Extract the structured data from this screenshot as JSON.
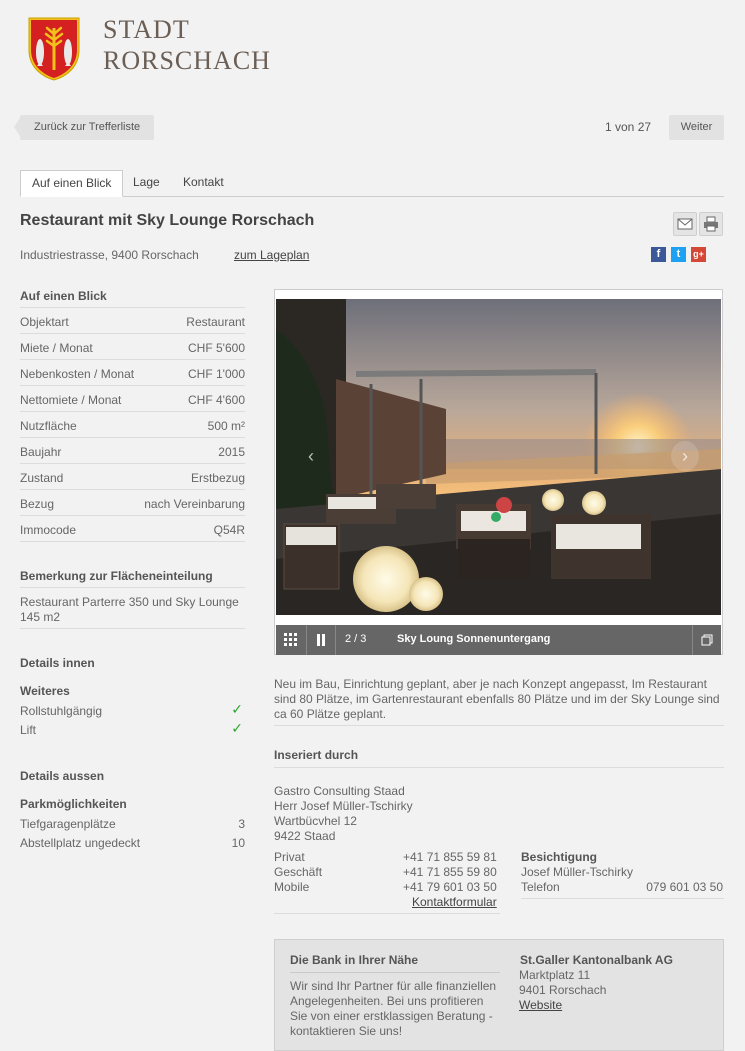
{
  "header": {
    "brand_line1": "STADT",
    "brand_line2": "RORSCHACH"
  },
  "nav": {
    "back_label": "Zurück zur Trefferliste",
    "pager": "1 von 27",
    "next_label": "Weiter"
  },
  "tabs": [
    {
      "label": "Auf einen Blick"
    },
    {
      "label": "Lage"
    },
    {
      "label": "Kontakt"
    }
  ],
  "listing": {
    "title": "Restaurant mit Sky Lounge Rorschach",
    "address": "Industriestrasse, 9400 Rorschach",
    "map_link": "zum Lageplan"
  },
  "social": {
    "facebook": "f",
    "twitter": "t",
    "google": "g+"
  },
  "overview": {
    "heading": "Auf einen Blick",
    "rows": [
      {
        "label": "Objektart",
        "value": "Restaurant"
      },
      {
        "label": "Miete / Monat",
        "value": "CHF 5'600"
      },
      {
        "label": "Nebenkosten / Monat",
        "value": "CHF 1'000"
      },
      {
        "label": "Nettomiete / Monat",
        "value": "CHF 4'600"
      },
      {
        "label": "Nutzfläche",
        "value": "500 m²"
      },
      {
        "label": "Baujahr",
        "value": "2015"
      },
      {
        "label": "Zustand",
        "value": "Erstbezug"
      },
      {
        "label": "Bezug",
        "value": "nach Vereinbarung"
      },
      {
        "label": "Immocode",
        "value": "Q54R"
      }
    ]
  },
  "floor_note": {
    "heading": "Bemerkung zur Flächeneinteilung",
    "text": "Restaurant Parterre 350 und Sky Lounge 145 m2"
  },
  "details_inside": {
    "heading": "Details innen",
    "subheading": "Weiteres",
    "rows": [
      {
        "label": "Rollstuhlgängig",
        "value": "✓"
      },
      {
        "label": "Lift",
        "value": "✓"
      }
    ]
  },
  "details_outside": {
    "heading": "Details aussen",
    "subheading": "Parkmöglichkeiten",
    "rows": [
      {
        "label": "Tiefgaragenplätze",
        "value": "3"
      },
      {
        "label": "Abstellplatz ungedeckt",
        "value": "10"
      }
    ]
  },
  "gallery": {
    "counter": "2 / 3",
    "caption": "Sky Loung Sonnenuntergang"
  },
  "description": "Neu im Bau, Einrichtung geplant, aber je nach Konzept angepasst, Im Restaurant sind 80 Plätze, im Gartenrestaurant ebenfalls 80 Plätze und im der Sky Lounge sind ca 60 Plätze geplant.",
  "advertiser": {
    "heading": "Inseriert durch",
    "company": "Gastro Consulting Staad",
    "person": "Herr Josef Müller-Tschirky",
    "street": "Wartbücvhel 12",
    "city": "9422 Staad",
    "phones": [
      {
        "label": "Privat",
        "value": "+41 71 855 59 81"
      },
      {
        "label": "Geschäft",
        "value": "+41 71 855 59 80"
      },
      {
        "label": "Mobile",
        "value": "+41 79 601 03 50"
      }
    ],
    "contact_form": "Kontaktformular",
    "viewing": {
      "heading": "Besichtigung",
      "name": "Josef Müller-Tschirky",
      "phone_label": "Telefon",
      "phone": "079 601 03 50"
    }
  },
  "bank": {
    "heading": "Die Bank in Ihrer Nähe",
    "text": "Wir sind Ihr Partner für alle finanziellen Angelegenheiten. Bei uns profitieren Sie von einer erstklassigen Beratung - kontaktieren Sie uns!",
    "name": "St.Galler Kantonalbank AG",
    "street": "Marktplatz 11",
    "city": "9401 Rorschach",
    "website": "Website"
  },
  "colors": {
    "shield_red": "#d42020",
    "shield_yellow": "#f3c21a",
    "check_green": "#2aa52a",
    "facebook": "#3b5998",
    "twitter": "#1da1f2",
    "google": "#d34836"
  }
}
